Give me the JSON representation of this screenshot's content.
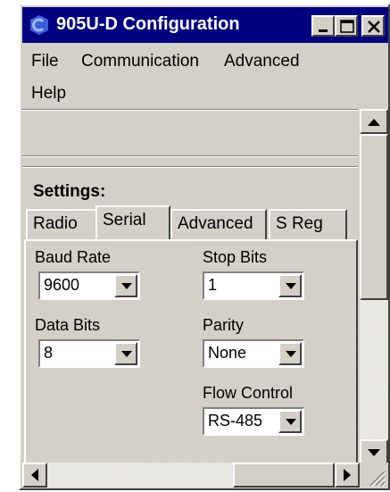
{
  "window": {
    "title": "905U-D Configuration",
    "accent": "#000080",
    "face": "#d4d0c8"
  },
  "menu": {
    "items": [
      {
        "label": "File"
      },
      {
        "label": "Communication"
      },
      {
        "label": "Advanced"
      },
      {
        "label": "Help"
      }
    ]
  },
  "settings": {
    "title": "Settings:",
    "tabs": [
      {
        "label": "Radio"
      },
      {
        "label": "Serial"
      },
      {
        "label": "Advanced"
      },
      {
        "label": "S Reg"
      }
    ],
    "active_tab": "Serial",
    "fields": {
      "baud_rate": {
        "label": "Baud Rate",
        "value": "9600"
      },
      "stop_bits": {
        "label": "Stop Bits",
        "value": "1"
      },
      "data_bits": {
        "label": "Data Bits",
        "value": "8"
      },
      "parity": {
        "label": "Parity",
        "value": "None"
      },
      "flow_control": {
        "label": "Flow Control",
        "value": "RS-485"
      }
    }
  }
}
